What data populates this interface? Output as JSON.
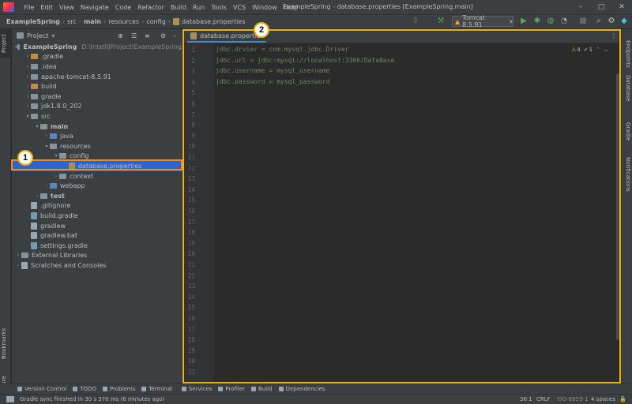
{
  "menu": {
    "items": [
      "File",
      "Edit",
      "View",
      "Navigate",
      "Code",
      "Refactor",
      "Build",
      "Run",
      "Tools",
      "VCS",
      "Window",
      "Help"
    ]
  },
  "window": {
    "title": "ExampleSpring - database.properties [ExampleSpring.main]"
  },
  "breadcrumb": {
    "items": [
      "ExampleSpring",
      "src",
      "main",
      "resources",
      "config",
      "database.properties"
    ]
  },
  "toolbar": {
    "run_config": "Tomcat 8.5.91"
  },
  "left_stripe": {
    "project": "Project",
    "bookmarks": "Bookmarks",
    "structure": "Structure"
  },
  "project_panel": {
    "title": "Project",
    "root_name": "ExampleSpring",
    "root_path": "D:\\IntelliJProject\\ExampleSpring",
    "tree": [
      {
        "label": ".gradle",
        "kind": "folder-orange"
      },
      {
        "label": ".idea",
        "kind": "folder"
      },
      {
        "label": "apache-tomcat-8.5.91",
        "kind": "folder"
      },
      {
        "label": "build",
        "kind": "folder-orange"
      },
      {
        "label": "gradle",
        "kind": "folder"
      },
      {
        "label": "jdk1.8.0_202",
        "kind": "folder"
      },
      {
        "label": "src",
        "kind": "folder"
      },
      {
        "label": "main",
        "kind": "folder"
      },
      {
        "label": "java",
        "kind": "folder-blue"
      },
      {
        "label": "resources",
        "kind": "folder"
      },
      {
        "label": "config",
        "kind": "folder"
      },
      {
        "label": "database.properties",
        "kind": "file-prop"
      },
      {
        "label": "context",
        "kind": "folder"
      },
      {
        "label": "webapp",
        "kind": "folder-blue"
      },
      {
        "label": "test",
        "kind": "folder"
      },
      {
        "label": ".gitignore",
        "kind": "file"
      },
      {
        "label": "build.gradle",
        "kind": "file-gradle"
      },
      {
        "label": "gradlew",
        "kind": "file"
      },
      {
        "label": "gradlew.bat",
        "kind": "file"
      },
      {
        "label": "settings.gradle",
        "kind": "file-gradle"
      },
      {
        "label": "External Libraries",
        "kind": "lib"
      },
      {
        "label": "Scratches and Consoles",
        "kind": "scratch"
      }
    ]
  },
  "editor": {
    "tab": "database.properties",
    "warnings": "4",
    "checks": "1",
    "lines": [
      "jdbc.drvier = com.mysql.jdbc.Driver",
      "jdbc.url = jdbc:mysql://localhost:3306/DataBase",
      "jdbc.username = mysql_username",
      "jdbc.password = mysql_password"
    ],
    "line_count": 31
  },
  "right_stripe": {
    "endpoints": "Endpoints",
    "database": "Database",
    "gradle": "Gradle",
    "notifications": "Notifications"
  },
  "tool_windows": [
    "Version Control",
    "TODO",
    "Problems",
    "Terminal",
    "Services",
    "Profiler",
    "Build",
    "Dependencies"
  ],
  "status": {
    "message": "Gradle sync finished in 30 s 370 ms (6 minutes ago)",
    "position": "36:1",
    "line_sep": "CRLF",
    "encoding": "ISO-8859-1",
    "indent": "4 spaces"
  },
  "callouts": [
    "1",
    "2"
  ]
}
